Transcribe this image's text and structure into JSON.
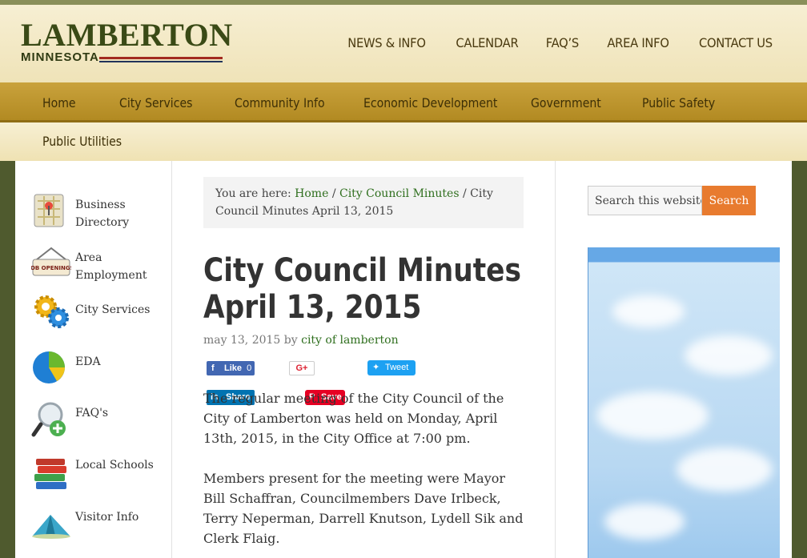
{
  "site": {
    "logo_main": "LAMBERTON",
    "logo_sub": "MINNESOTA"
  },
  "topnav": [
    "NEWS & INFO",
    "CALENDAR",
    "FAQ’S",
    "AREA INFO",
    "CONTACT US"
  ],
  "mainnav": [
    "Home",
    "City Services",
    "Community Info",
    "Economic Development",
    "Government",
    "Public Safety"
  ],
  "subnav": [
    "Public Utilities"
  ],
  "leftbar": [
    {
      "label": "Business Directory",
      "icon": "map-icon"
    },
    {
      "label": "Area Employment",
      "icon": "job-openings-icon"
    },
    {
      "label": "City Services",
      "icon": "gears-icon"
    },
    {
      "label": "EDA",
      "icon": "pie-chart-icon"
    },
    {
      "label": "FAQ's",
      "icon": "magnifier-plus-icon"
    },
    {
      "label": "Local Schools",
      "icon": "books-icon"
    },
    {
      "label": "Visitor Info",
      "icon": "tent-icon"
    }
  ],
  "breadcrumb": {
    "prefix": "You are here:",
    "home": "Home",
    "sep": "/",
    "section": "City Council Minutes",
    "current": "City Council Minutes April 13, 2015"
  },
  "post": {
    "title": "City Council Minutes April 13, 2015",
    "date": "may 13, 2015",
    "by": "by",
    "author": "city of lamberton",
    "para1": "The regular meeting of the City Council of the City of Lamberton was held on Monday, April 13th, 2015, in the City Office at 7:00 pm.",
    "para2": "Members present for the meeting were Mayor Bill Schaffran, Councilmembers Dave Irlbeck, Terry Neperman, Darrell Knutson, Lydell Sik and Clerk Flaig."
  },
  "share": {
    "fb_label": "Like",
    "fb_count": "0",
    "gplus_label": "G+",
    "tweet_label": "Tweet",
    "linkedin_label": "Share",
    "pin_label": "Save"
  },
  "search": {
    "value": "Search this website ...",
    "button": "Search"
  },
  "colors": {
    "nav_bg": "#c9a23c",
    "header_bg": "#f7efd3",
    "link": "#2f6f1e",
    "search_btn": "#e87b2f",
    "page_bg": "#4f5a2e"
  }
}
